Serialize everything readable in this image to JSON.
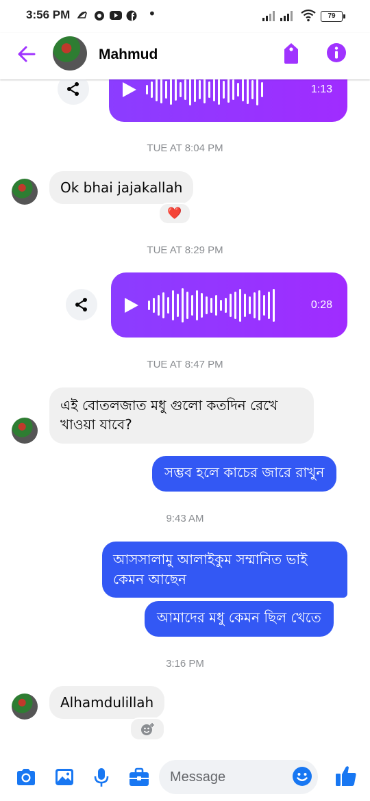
{
  "status_bar": {
    "time": "3:56 PM",
    "battery": "79"
  },
  "header": {
    "name": "Mahmud"
  },
  "messages": {
    "voice1": {
      "duration": "1:13"
    },
    "ts1": "TUE AT 8:04 PM",
    "in1": {
      "text": "Ok bhai jajakallah",
      "reaction": "❤️"
    },
    "ts2": "TUE AT 8:29 PM",
    "voice2": {
      "duration": "0:28"
    },
    "ts3": "TUE AT 8:47 PM",
    "in2": {
      "line1": "এই বোতলজাত মধু গুলো কতদিন রেখে",
      "line2": "খাওয়া যাবে?"
    },
    "out1": {
      "text": "সম্ভব হলে কাচের জারে রাখুন"
    },
    "ts4": "9:43 AM",
    "out2": {
      "line1": "আসসালামু আলাইকুম সম্মানিত ভাই",
      "line2": "কেমন আছেন"
    },
    "out3": {
      "text": "আমাদের মধু কেমন ছিল খেতে"
    },
    "ts5": "3:16 PM",
    "in3": {
      "text": "Alhamdulillah"
    }
  },
  "composer": {
    "placeholder": "Message"
  },
  "icons": {
    "accent": "#a033ff",
    "outgoing_bubble": "#3358f4",
    "composer_blue": "#1877f2"
  }
}
